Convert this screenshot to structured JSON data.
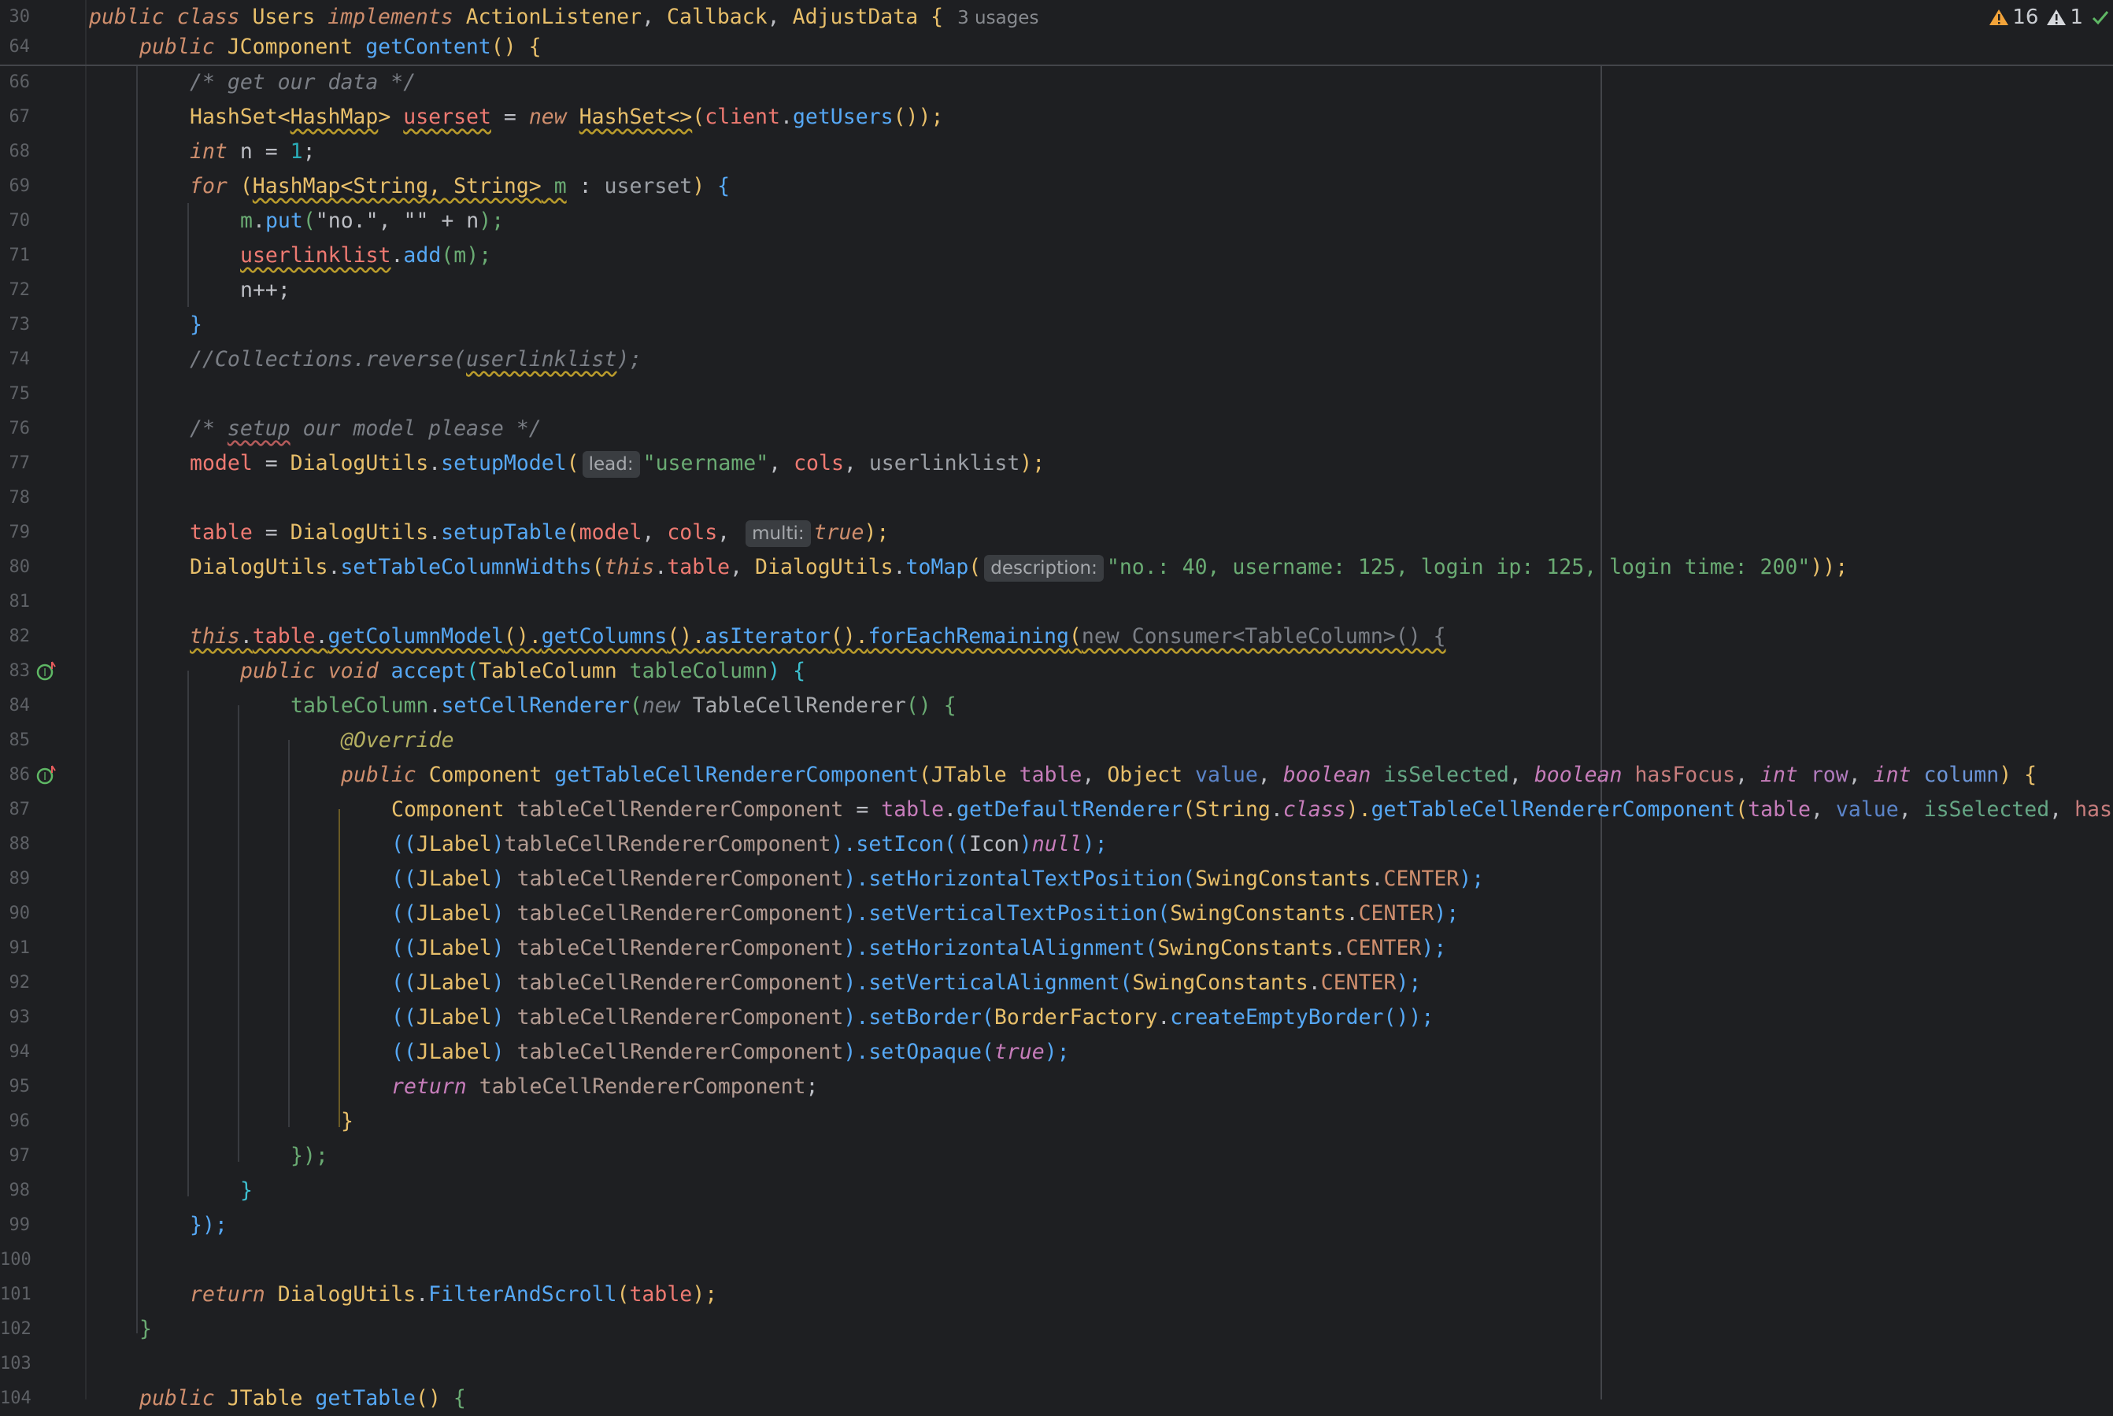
{
  "colors": {
    "background": "#1e1f22",
    "keyword": "#cf8e6d",
    "function": "#56a8f5",
    "string": "#6aab73",
    "number": "#2aacb8",
    "comment": "#7a7e85",
    "field": "#ef7a72",
    "warning": "#f2a33a",
    "ok": "#5fb865"
  },
  "inspections": {
    "warnings_count": "16",
    "weak_warnings_count": "1",
    "warning_icon": "warning-triangle-icon",
    "weak_warning_icon": "weak-warning-triangle-icon",
    "ok_icon": "check-icon"
  },
  "sticky": {
    "line30_no": "30",
    "line30": {
      "kw1": "public",
      "kw2": "class",
      "name": "Users",
      "kw3": "implements",
      "t1": "ActionListener",
      "c1": ",",
      "t2": "Callback",
      "c2": ",",
      "t3": "AdjustData",
      "brace": "{",
      "usages": "3 usages"
    },
    "line64_no": "64",
    "line64": {
      "kw": "public",
      "type": "JComponent",
      "fn": "getContent",
      "paren": "()",
      "brace": "{"
    }
  },
  "gutter_icons": {
    "line83": "implements-method-icon",
    "line86": "implements-method-icon"
  },
  "lines": {
    "l66": {
      "no": "66",
      "c": "/* get our data */"
    },
    "l67": {
      "no": "67",
      "t1": "HashSet<",
      "t2": "HashMap",
      "t3": ">",
      "var": "userset",
      "eq": " = ",
      "kw": "new",
      "t4": "HashSet<>",
      "p1": "(",
      "fld": "client",
      "dot": ".",
      "fn": "getUsers",
      "p2": "());"
    },
    "l68": {
      "no": "68",
      "kw": "int",
      "rest": " n = ",
      "num": "1",
      "end": ";"
    },
    "l69": {
      "no": "69",
      "kw": "for",
      "p1": " (",
      "t1": "HashMap<String, String>",
      "var": " m",
      "colon": " : ",
      "set": "userset",
      "p2": ")",
      "brace": " {"
    },
    "l70": {
      "no": "70",
      "v": "m",
      "dot": ".",
      "fn": "put",
      "p1": "(",
      "s1": "\"no.\"",
      "c": ", ",
      "s2": "\"\"",
      "rest": " + n",
      "p2": ");"
    },
    "l71": {
      "no": "71",
      "fld": "userlinklist",
      "dot": ".",
      "fn": "add",
      "p1": "(",
      "v": "m",
      "p2": ");"
    },
    "l72": {
      "no": "72",
      "c": "n++;"
    },
    "l73": {
      "no": "73",
      "c": "}"
    },
    "l74": {
      "no": "74",
      "c1": "//Collections.reverse(",
      "c2": "userlinklist",
      "c3": ");"
    },
    "l75": {
      "no": "75"
    },
    "l76": {
      "no": "76",
      "c1": "/* ",
      "c2": "setup",
      "c3": " our model please */"
    },
    "l77": {
      "no": "77",
      "fld": "model",
      "eq": " = ",
      "cls": "DialogUtils",
      "dot": ".",
      "fn": "setupModel",
      "p1": "(",
      "hint": "lead:",
      "s": "\"username\"",
      "c1": ", ",
      "f2": "cols",
      "c2": ", ",
      "f3": "userlinklist",
      "p2": ");"
    },
    "l78": {
      "no": "78"
    },
    "l79": {
      "no": "79",
      "fld": "table",
      "eq": " = ",
      "cls": "DialogUtils",
      "dot": ".",
      "fn": "setupTable",
      "p1": "(",
      "f2": "model",
      "c1": ", ",
      "f3": "cols",
      "c2": ", ",
      "hint": "multi:",
      "kw": "true",
      "p2": ");"
    },
    "l80": {
      "no": "80",
      "cls": "DialogUtils",
      "dot": ".",
      "fn": "setTableColumnWidths",
      "p1": "(",
      "kw": "this",
      "dot2": ".",
      "fld": "table",
      "c1": ", ",
      "cls2": "DialogUtils",
      "dot3": ".",
      "fn2": "toMap",
      "p2": "(",
      "hint": "description:",
      "s": "\"no.: 40, username: 125, login ip: 125, login time: 200\"",
      "p3": "));"
    },
    "l81": {
      "no": "81"
    },
    "l82": {
      "no": "82",
      "kw": "this",
      "dot": ".",
      "fld": "table",
      "dot2": ".",
      "fn1": "getColumnModel",
      "p1": "().",
      "fn2": "getColumns",
      "p2": "().",
      "fn3": "asIterator",
      "p3": "().",
      "fn4": "forEachRemaining",
      "p4": "(",
      "rest": "new Consumer<TableColumn>() {"
    },
    "l83": {
      "no": "83",
      "kw1": "public",
      "kw2": "void",
      "fn": "accept",
      "p1": "(",
      "t": "TableColumn",
      "prm": " tableColumn",
      "p2": ")",
      "brace": " {"
    },
    "l84": {
      "no": "84",
      "v": "tableColumn",
      "dot": ".",
      "fn": "setCellRenderer",
      "p1": "(",
      "kw": "new",
      "t": " TableCellRenderer",
      "p2": "()",
      "brace": " {"
    },
    "l85": {
      "no": "85",
      "ann": "@Override"
    },
    "l86": {
      "no": "86",
      "kw": "public",
      "t": "Component",
      "fn": "getTableCellRendererComponent",
      "p1": "(",
      "t1": "JTable",
      "a1": " table",
      "c1": ", ",
      "t2": "Object",
      "a2": " value",
      "c2": ", ",
      "k3": "boolean",
      "a3": " isSelected",
      "c3": ", ",
      "k4": "boolean",
      "a4": " hasFocus",
      "c4": ", ",
      "k5": "int",
      "a5": " row",
      "c5": ", ",
      "k6": "int",
      "a6": " column",
      "p2": ")",
      "brace": " {"
    },
    "l87": {
      "no": "87",
      "t": "Component",
      "v": " tableCellRendererComponent",
      "eq": " = ",
      "a": "table",
      "dot": ".",
      "fn": "getDefaultRenderer",
      "p1": "(",
      "t2": "String",
      "dot2": ".",
      "kw": "class",
      "p2": ").",
      "fn2": "getTableCellRendererComponent",
      "p3": "(",
      "a1": "table",
      "c1": ", ",
      "a2": "value",
      "c2": ", ",
      "a3": "isSelected",
      "c3": ", ",
      "a4": "has"
    },
    "l88": {
      "no": "88",
      "p1": "((",
      "t": "JLabel",
      "p2": ")",
      "v": "tableCellRendererComponent",
      "p3": ").",
      "fn": "setIcon",
      "p4": "((",
      "t2": "Icon",
      "p5": ")",
      "kw": "null",
      "p6": ");"
    },
    "l89": {
      "no": "89",
      "p1": "((",
      "t": "JLabel",
      "p2": ") ",
      "v": "tableCellRendererComponent",
      "p3": ").",
      "fn": "setHorizontalTextPosition",
      "p4": "(",
      "cls": "SwingConstants",
      "dot": ".",
      "k": "CENTER",
      "p5": ");"
    },
    "l90": {
      "no": "90",
      "p1": "((",
      "t": "JLabel",
      "p2": ") ",
      "v": "tableCellRendererComponent",
      "p3": ").",
      "fn": "setVerticalTextPosition",
      "p4": "(",
      "cls": "SwingConstants",
      "dot": ".",
      "k": "CENTER",
      "p5": ");"
    },
    "l91": {
      "no": "91",
      "p1": "((",
      "t": "JLabel",
      "p2": ") ",
      "v": "tableCellRendererComponent",
      "p3": ").",
      "fn": "setHorizontalAlignment",
      "p4": "(",
      "cls": "SwingConstants",
      "dot": ".",
      "k": "CENTER",
      "p5": ");"
    },
    "l92": {
      "no": "92",
      "p1": "((",
      "t": "JLabel",
      "p2": ") ",
      "v": "tableCellRendererComponent",
      "p3": ").",
      "fn": "setVerticalAlignment",
      "p4": "(",
      "cls": "SwingConstants",
      "dot": ".",
      "k": "CENTER",
      "p5": ");"
    },
    "l93": {
      "no": "93",
      "p1": "((",
      "t": "JLabel",
      "p2": ") ",
      "v": "tableCellRendererComponent",
      "p3": ").",
      "fn": "setBorder",
      "p4": "(",
      "cls": "BorderFactory",
      "dot": ".",
      "fn2": "createEmptyBorder",
      "p5": "());"
    },
    "l94": {
      "no": "94",
      "p1": "((",
      "t": "JLabel",
      "p2": ") ",
      "v": "tableCellRendererComponent",
      "p3": ").",
      "fn": "setOpaque",
      "p4": "(",
      "kw": "true",
      "p5": ");"
    },
    "l95": {
      "no": "95",
      "kw": "return",
      "v": " tableCellRendererComponent",
      "end": ";"
    },
    "l96": {
      "no": "96",
      "c": "}"
    },
    "l97": {
      "no": "97",
      "c": "});"
    },
    "l98": {
      "no": "98",
      "c": "}"
    },
    "l99": {
      "no": "99",
      "c": "});"
    },
    "l100": {
      "no": "100"
    },
    "l101": {
      "no": "101",
      "kw": "return",
      "cls": " DialogUtils",
      "dot": ".",
      "fn": "FilterAndScroll",
      "p1": "(",
      "fld": "table",
      "p2": ");"
    },
    "l102": {
      "no": "102",
      "c": "}"
    },
    "l103": {
      "no": "103"
    },
    "l104": {
      "no": "104",
      "kw": "public",
      "t": " JTable",
      "fn": " getTable",
      "p": "()",
      "brace": " {"
    }
  }
}
